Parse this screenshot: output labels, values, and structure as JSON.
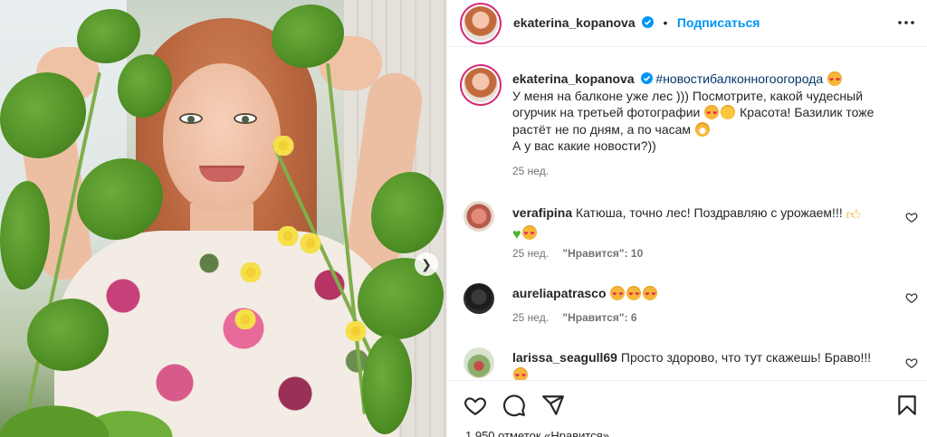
{
  "post": {
    "author": "ekaterina_kopanova",
    "follow_label": "Подписаться",
    "caption": {
      "hashtag": "#новостибалконногоогорода",
      "line1": "У меня на балконе уже лес ))) Посмотрите, какой чудесный",
      "line2": "огурчик на третьей фотографии",
      "line2b": "Красота! Базилик тоже",
      "line3": "растёт не по дням, а по часам",
      "line4": "А у вас какие новости?))",
      "time": "25 нед."
    }
  },
  "comments": [
    {
      "user": "verafipina",
      "text": "Катюша, точно лес! Поздравляю с урожаем!!!",
      "time": "25 нед.",
      "likes_label": "\"Нравится\": 10"
    },
    {
      "user": "aureliapatrasco",
      "text": "",
      "time": "25 нед.",
      "likes_label": "\"Нравится\": 6"
    },
    {
      "user": "larissa_seagull69",
      "text": "Просто здорово, что тут скажешь! Браво!!!"
    }
  ],
  "footer_partial": "1 950 отметок «Нравится»",
  "colors": {
    "accent": "#0095f6",
    "hashtag": "#00376b",
    "muted": "#737373",
    "ring": "#d62976"
  },
  "icons": [
    "verified-badge-icon",
    "more-options-icon",
    "heart-icon",
    "comment-icon",
    "share-icon",
    "bookmark-icon",
    "chevron-right-icon"
  ]
}
